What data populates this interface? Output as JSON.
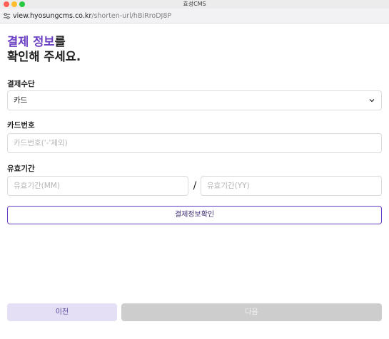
{
  "window": {
    "title": "효성CMS",
    "controls": [
      "close",
      "minimize",
      "zoom"
    ]
  },
  "address_bar": {
    "domain": "view.hyosungcms.co.kr",
    "path": "/shorten-url/hBiRroDJ8P",
    "site_icon": "site-settings-icon"
  },
  "heading": {
    "accent": "결제 정보",
    "rest_line1": "를",
    "line2": "확인해 주세요."
  },
  "payment_method": {
    "label": "결제수단",
    "selected": "카드",
    "icon": "chevron-down-icon"
  },
  "card_number": {
    "label": "카드번호",
    "placeholder": "카드번호('-'제외)",
    "value": ""
  },
  "expiry": {
    "label": "유효기간",
    "month_placeholder": "유효기간(MM)",
    "year_placeholder": "유효기간(YY)",
    "separator": "/"
  },
  "buttons": {
    "confirm": "결제정보확인",
    "prev": "이전",
    "next": "다음"
  },
  "colors": {
    "accent": "#6a3ec2",
    "prev_bg": "#e4dff4",
    "next_disabled_bg": "#cdcdcd"
  }
}
